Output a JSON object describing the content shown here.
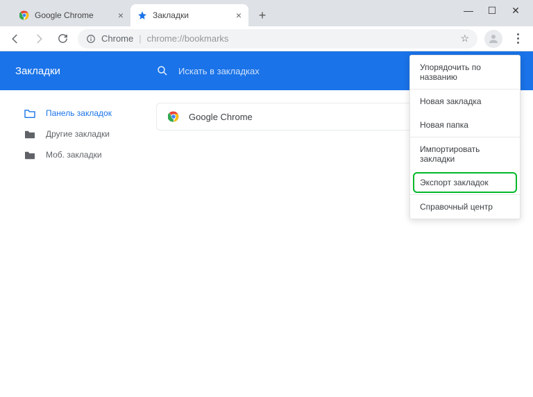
{
  "winControls": {
    "min": "—",
    "max": "☐",
    "close": "✕"
  },
  "tabs": [
    {
      "title": "Google Chrome",
      "active": false,
      "icon": "chrome"
    },
    {
      "title": "Закладки",
      "active": true,
      "icon": "star"
    }
  ],
  "newTab": "+",
  "toolbar": {
    "chromeLabel": "Chrome",
    "sep": "|",
    "url": "chrome://bookmarks"
  },
  "page": {
    "title": "Закладки",
    "searchPlaceholder": "Искать в закладках"
  },
  "sidebar": {
    "items": [
      {
        "label": "Панель закладок",
        "active": true
      },
      {
        "label": "Другие закладки",
        "active": false
      },
      {
        "label": "Моб. закладки",
        "active": false
      }
    ]
  },
  "bookmarks": [
    {
      "label": "Google Chrome",
      "icon": "chrome"
    }
  ],
  "dropdown": {
    "sort": "Упорядочить по названию",
    "newBookmark": "Новая закладка",
    "newFolder": "Новая папка",
    "import": "Импортировать закладки",
    "export": "Экспорт закладок",
    "help": "Справочный центр"
  }
}
